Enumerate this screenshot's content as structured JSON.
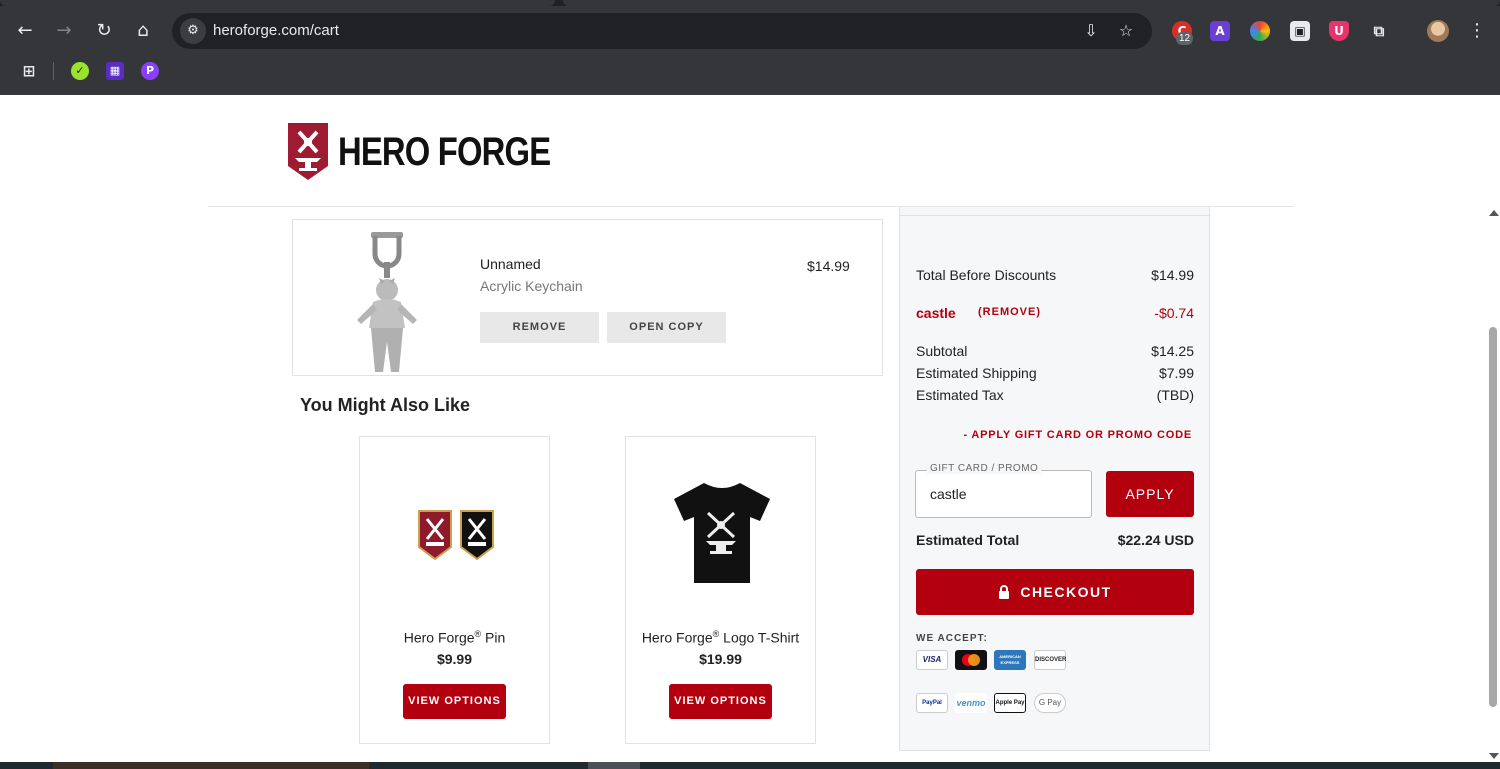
{
  "browser": {
    "url": "heroforge.com/cart",
    "extension_badge": "12"
  },
  "brand": {
    "name": "HERO FORGE",
    "accent": "#b3000f"
  },
  "cart": {
    "items": [
      {
        "name": "Unnamed",
        "type": "Acrylic Keychain",
        "price": "$14.99",
        "remove_label": "REMOVE",
        "copy_label": "OPEN COPY"
      }
    ]
  },
  "recommendations": {
    "title": "You Might Also Like",
    "items": [
      {
        "name": "Hero Forge",
        "mark": "®",
        "suffix": " Pin",
        "price": "$9.99",
        "button": "VIEW OPTIONS"
      },
      {
        "name": "Hero Forge",
        "mark": "®",
        "suffix": " Logo T-Shirt",
        "price": "$19.99",
        "button": "VIEW OPTIONS"
      }
    ]
  },
  "summary": {
    "total_before_discounts_label": "Total Before Discounts",
    "total_before_discounts": "$14.99",
    "promo_code": "castle",
    "promo_remove": "(REMOVE)",
    "promo_discount": "-$0.74",
    "subtotal_label": "Subtotal",
    "subtotal": "$14.25",
    "shipping_label": "Estimated Shipping",
    "shipping": "$7.99",
    "tax_label": "Estimated Tax",
    "tax": "(TBD)",
    "apply_link": "- APPLY GIFT CARD OR PROMO CODE",
    "promo_field_label": "GIFT CARD / PROMO",
    "promo_field_value": "castle",
    "apply_button": "APPLY",
    "estimated_total_label": "Estimated Total",
    "estimated_total": "$22.24 USD",
    "checkout_button": "CHECKOUT",
    "we_accept": "WE ACCEPT:",
    "payment_methods": [
      "VISA",
      "Mastercard",
      "AMERICAN EXPRESS",
      "DISCOVER",
      "PayPal",
      "venmo",
      "Apple Pay",
      "G Pay"
    ]
  }
}
